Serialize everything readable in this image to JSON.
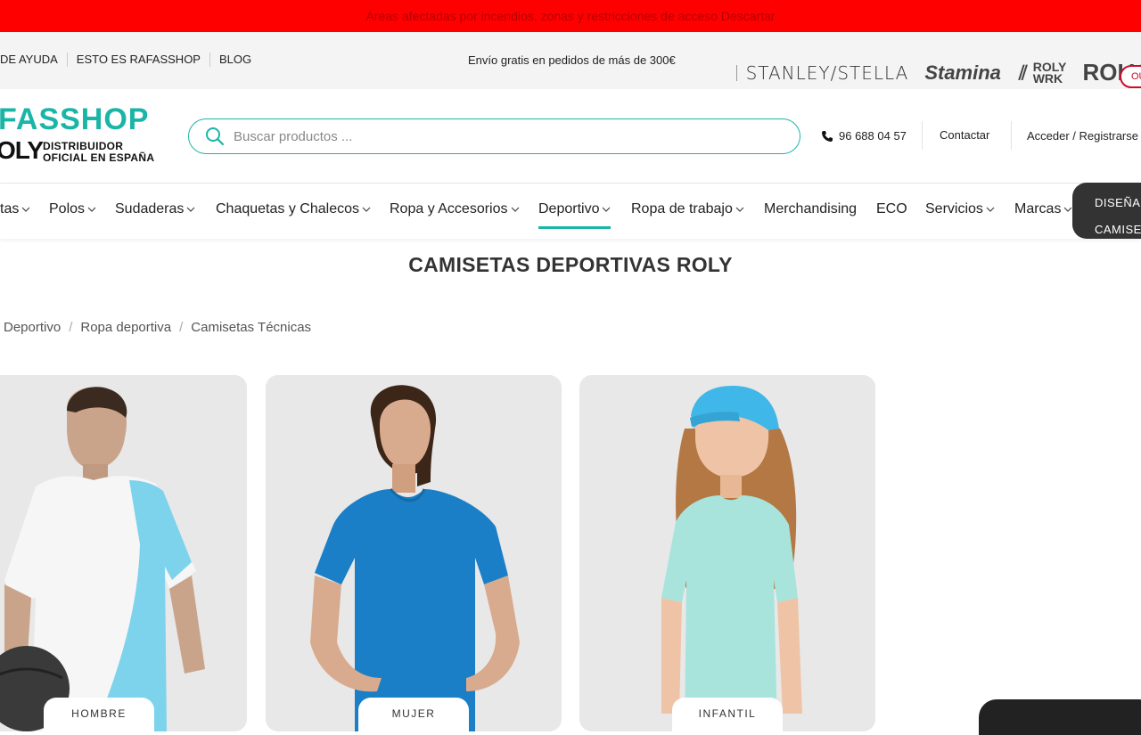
{
  "alert": {
    "text": "Áreas afectadas por incendios, zonas y restricciones de acceso Descartar"
  },
  "topbar": {
    "links": [
      "DE AYUDA",
      "ESTO ES RAFASSHOP",
      "BLOG"
    ],
    "shipping": "Envío gratis en pedidos de más de 300€",
    "brands": [
      "STANLEY/STELLA",
      "Stamina",
      "ROLY WRK",
      "ROLY"
    ],
    "pill": "OU"
  },
  "header": {
    "logo_main": "FASSHOP",
    "logo_roly": "OLY",
    "logo_dist_1": "DISTRIBUIDOR",
    "logo_dist_2": "OFICIAL EN ESPAÑA",
    "search_placeholder": "Buscar productos ...",
    "phone": "96 688 04 57",
    "contact": "Contactar",
    "login": "Acceder / Registrarse"
  },
  "nav": {
    "items": [
      {
        "label": "tas",
        "chevron": true
      },
      {
        "label": "Polos",
        "chevron": true
      },
      {
        "label": "Sudaderas",
        "chevron": true
      },
      {
        "label": "Chaquetas y Chalecos",
        "chevron": true
      },
      {
        "label": "Ropa y Accesorios",
        "chevron": true
      },
      {
        "label": "Deportivo",
        "chevron": true,
        "active": true
      },
      {
        "label": "Ropa de trabajo",
        "chevron": true
      },
      {
        "label": "Merchandising",
        "chevron": false
      },
      {
        "label": "ECO",
        "chevron": false
      },
      {
        "label": "Servicios",
        "chevron": true
      },
      {
        "label": "Marcas",
        "chevron": true
      }
    ],
    "design_line1": "DISEÑA",
    "design_line2": "CAMISE"
  },
  "page": {
    "title": "CAMISETAS DEPORTIVAS ROLY",
    "breadcrumb": [
      "Deportivo",
      "Ropa deportiva",
      "Camisetas Técnicas"
    ]
  },
  "cards": [
    {
      "label": "HOMBRE",
      "shirt_color": "#ffffff",
      "accent": "#7dd3ec"
    },
    {
      "label": "MUJER",
      "shirt_color": "#1a7fc6"
    },
    {
      "label": "INFANTIL",
      "shirt_color": "#a8e4dc",
      "cap_color": "#3fb7e8"
    }
  ]
}
